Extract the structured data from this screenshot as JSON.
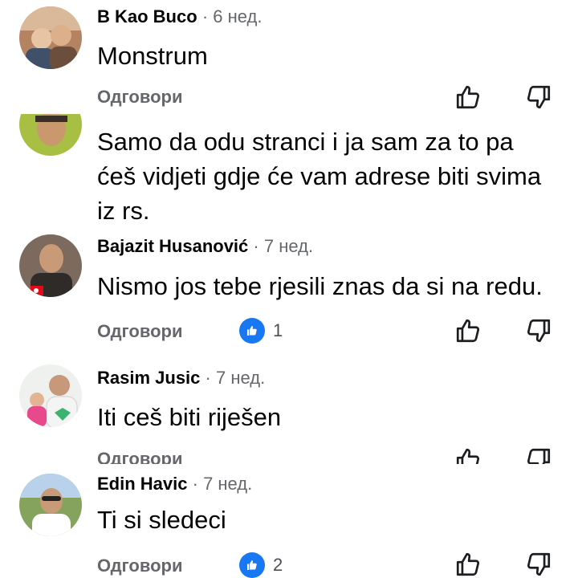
{
  "comments": [
    {
      "author": "B Kao Buco",
      "time": "6 нед.",
      "text": "Monstrum",
      "reply_label": "Одговори",
      "reaction_count": ""
    },
    {
      "author": "",
      "time": "",
      "text": "Samo da odu stranci i ja sam za to pa ćeš vidjeti gdje će vam adrese biti svima iz rs.",
      "reply_label": "",
      "reaction_count": ""
    },
    {
      "author": "Bajazit Husanović",
      "time": "7 нед.",
      "text": "Nismo jos tebe rjesili znas da si na redu.",
      "reply_label": "Одговори",
      "reaction_count": "1"
    },
    {
      "author": "Rasim Jusic",
      "time": "7 нед.",
      "text": "Iti ceš biti riješen",
      "reply_label": "Одговори",
      "reaction_count": ""
    },
    {
      "author": "Edin Havic",
      "time": "7 нед.",
      "text": "Ti si sledeci",
      "reply_label": "Одговори",
      "reaction_count": "2"
    }
  ],
  "separator": "·",
  "colors": {
    "accent": "#1877f2",
    "secondary_text": "#65676b"
  },
  "icons": {
    "like": "thumbs-up-outline",
    "dislike": "thumbs-down-outline",
    "reaction": "like-badge"
  }
}
